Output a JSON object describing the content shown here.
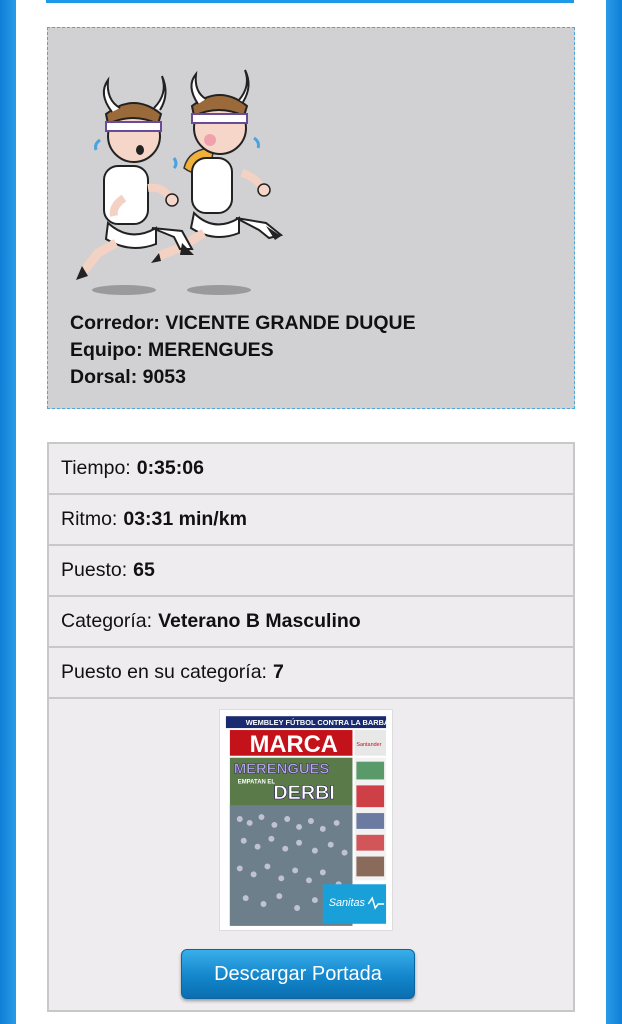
{
  "runner": {
    "name_line": "Corredor: VICENTE GRANDE DUQUE",
    "team_line": "Equipo: MERENGUES",
    "bib_line": "Dorsal: 9053"
  },
  "results": {
    "time": {
      "label": "Tiempo:",
      "value": "0:35:06"
    },
    "pace": {
      "label": "Ritmo:",
      "value": "03:31 min/km"
    },
    "position": {
      "label": "Puesto:",
      "value": "65"
    },
    "category": {
      "label": "Categoría:",
      "value": "Veterano B Masculino"
    },
    "category_position": {
      "label": "Puesto en su categoría:",
      "value": "7"
    }
  },
  "cover": {
    "headline_top": "WEMBLEY FÚTBOL CONTRA LA BARBARIE",
    "masthead": "MARCA",
    "title": "MERENGUES",
    "subtitle": "EMPATAN EL",
    "subtitle2": "DERBI",
    "sponsor": "Sanitas",
    "sponsor_small": "Santander",
    "icon": "marca-cover-image"
  },
  "actions": {
    "download_label": "Descargar Portada"
  },
  "colors": {
    "frame": "#1d8fe0",
    "card_bg": "#d1d1d3",
    "card_border": "#4ba8dd",
    "button": "#1486cc"
  }
}
